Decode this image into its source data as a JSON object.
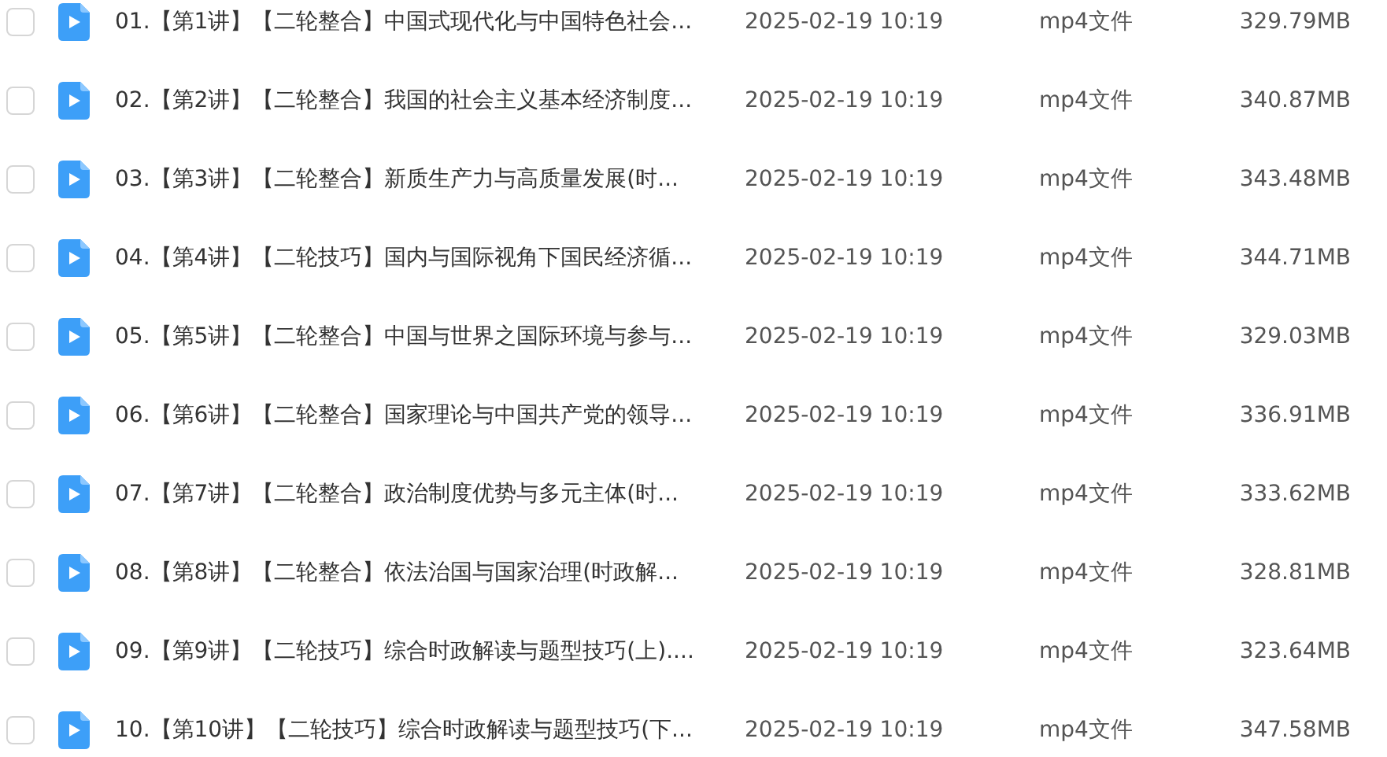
{
  "files": [
    {
      "name": "01.【第1讲】【二轮整合】中国式现代化与中国特色社会...",
      "date": "2025-02-19 10:19",
      "type": "mp4文件",
      "size": "329.79MB",
      "checked": false
    },
    {
      "name": "02.【第2讲】【二轮整合】我国的社会主义基本经济制度...",
      "date": "2025-02-19 10:19",
      "type": "mp4文件",
      "size": "340.87MB",
      "checked": false
    },
    {
      "name": "03.【第3讲】【二轮整合】新质生产力与高质量发展(时...",
      "date": "2025-02-19 10:19",
      "type": "mp4文件",
      "size": "343.48MB",
      "checked": false
    },
    {
      "name": "04.【第4讲】【二轮技巧】国内与国际视角下国民经济循...",
      "date": "2025-02-19 10:19",
      "type": "mp4文件",
      "size": "344.71MB",
      "checked": false
    },
    {
      "name": "05.【第5讲】【二轮整合】中国与世界之国际环境与参与...",
      "date": "2025-02-19 10:19",
      "type": "mp4文件",
      "size": "329.03MB",
      "checked": false
    },
    {
      "name": "06.【第6讲】【二轮整合】国家理论与中国共产党的领导...",
      "date": "2025-02-19 10:19",
      "type": "mp4文件",
      "size": "336.91MB",
      "checked": false
    },
    {
      "name": "07.【第7讲】【二轮整合】政治制度优势与多元主体(时...",
      "date": "2025-02-19 10:19",
      "type": "mp4文件",
      "size": "333.62MB",
      "checked": false
    },
    {
      "name": "08.【第8讲】【二轮整合】依法治国与国家治理(时政解...",
      "date": "2025-02-19 10:19",
      "type": "mp4文件",
      "size": "328.81MB",
      "checked": false
    },
    {
      "name": "09.【第9讲】【二轮技巧】综合时政解读与题型技巧(上)....",
      "date": "2025-02-19 10:19",
      "type": "mp4文件",
      "size": "323.64MB",
      "checked": false
    },
    {
      "name": "10.【第10讲】【二轮技巧】综合时政解读与题型技巧(下...",
      "date": "2025-02-19 10:19",
      "type": "mp4文件",
      "size": "347.58MB",
      "checked": false
    }
  ]
}
